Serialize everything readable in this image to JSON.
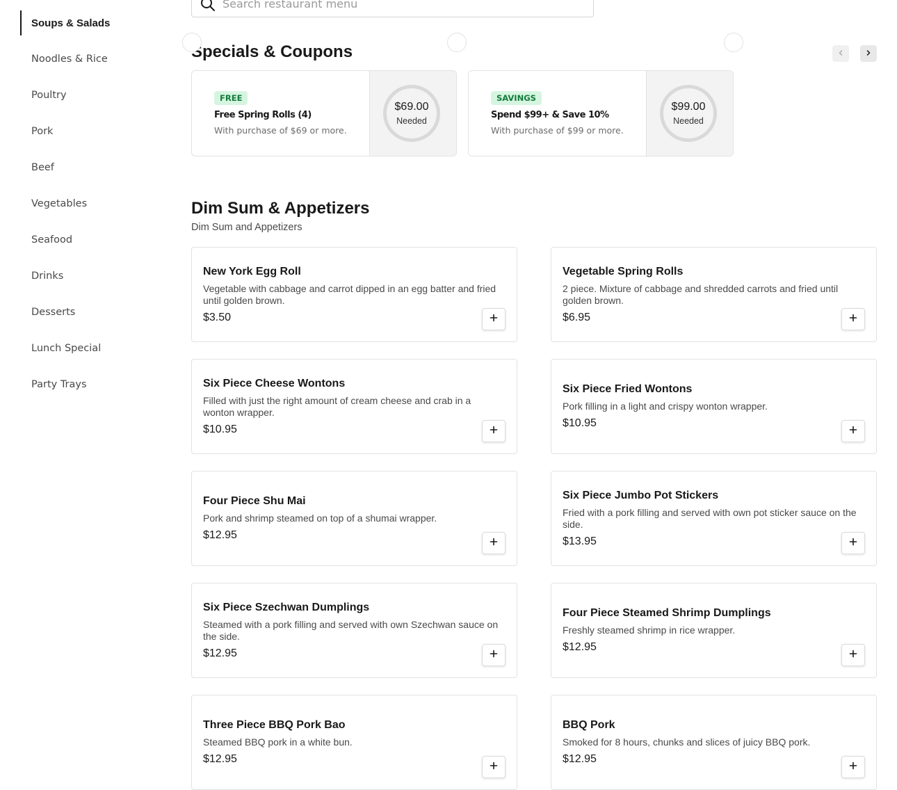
{
  "sidebar": {
    "items": [
      {
        "label": "Soups & Salads"
      },
      {
        "label": "Noodles & Rice"
      },
      {
        "label": "Poultry"
      },
      {
        "label": "Pork"
      },
      {
        "label": "Beef"
      },
      {
        "label": "Vegetables"
      },
      {
        "label": "Seafood"
      },
      {
        "label": "Drinks"
      },
      {
        "label": "Desserts"
      },
      {
        "label": "Lunch Special"
      },
      {
        "label": "Party Trays"
      }
    ]
  },
  "search": {
    "placeholder": "Search restaurant menu",
    "icon": "search-icon"
  },
  "specials": {
    "title": "Specials & Coupons",
    "prev_icon": "chevron-left-icon",
    "next_icon": "chevron-right-icon",
    "coupons": [
      {
        "badge": "FREE",
        "title": "Free Spring Rolls (4)",
        "subtitle": "With purchase of $69 or more.",
        "amount": "$69.00",
        "amount_label": "Needed"
      },
      {
        "badge": "SAVINGS",
        "title": "Spend $99+ & Save 10%",
        "subtitle": "With purchase of $99 or more.",
        "amount": "$99.00",
        "amount_label": "Needed"
      }
    ]
  },
  "section": {
    "title": "Dim Sum & Appetizers",
    "subtitle": "Dim Sum and Appetizers",
    "items": [
      {
        "name": "New York Egg Roll",
        "description": "Vegetable with cabbage and carrot dipped in an egg batter and fried until golden brown.",
        "price": "$3.50"
      },
      {
        "name": "Vegetable Spring Rolls",
        "description": "2 piece. Mixture of cabbage and shredded carrots and fried until golden brown.",
        "price": "$6.95"
      },
      {
        "name": "Six Piece Cheese Wontons",
        "description": "Filled with just the right amount of cream cheese and crab in a wonton wrapper.",
        "price": "$10.95"
      },
      {
        "name": "Six Piece Fried Wontons",
        "description": "Pork filling in a light and crispy wonton wrapper.",
        "price": "$10.95"
      },
      {
        "name": "Four Piece Shu Mai",
        "description": "Pork and shrimp steamed on top of a shumai wrapper.",
        "price": "$12.95"
      },
      {
        "name": "Six Piece Jumbo Pot Stickers",
        "description": "Fried with a pork filling and served with own pot sticker sauce on the side.",
        "price": "$13.95"
      },
      {
        "name": "Six Piece Szechwan Dumplings",
        "description": "Steamed with a pork filling and served with own Szechwan sauce on the side.",
        "price": "$12.95"
      },
      {
        "name": "Four Piece Steamed Shrimp Dumplings",
        "description": "Freshly steamed shrimp in rice wrapper.",
        "price": "$12.95"
      },
      {
        "name": "Three Piece BBQ Pork Bao",
        "description": "Steamed BBQ pork in a white bun.",
        "price": "$12.95"
      },
      {
        "name": "BBQ Pork",
        "description": "Smoked for 8 hours, chunks and slices of juicy BBQ pork.",
        "price": "$12.95"
      }
    ],
    "add_icon": "plus-icon"
  }
}
